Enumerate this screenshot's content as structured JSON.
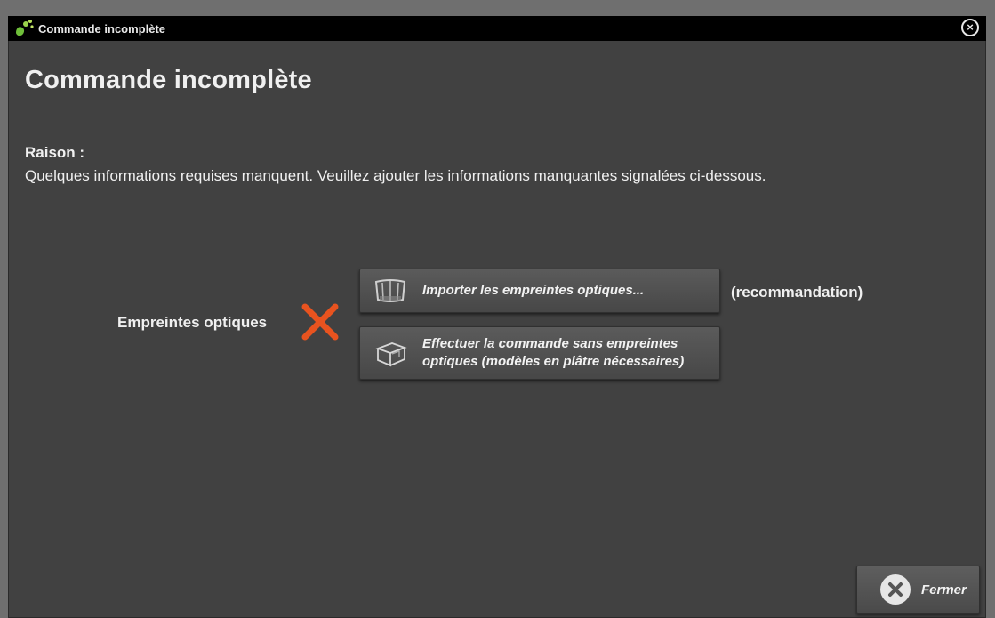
{
  "window": {
    "title": "Commande incomplète",
    "app_icon": "tooth-app-icon",
    "close_icon": "close-circle-icon"
  },
  "main": {
    "heading": "Commande incomplète",
    "reason_label": "Raison :",
    "reason_text": "Quelques informations requises manquent. Veuillez ajouter les informations manquantes signalées ci-dessous."
  },
  "requirement": {
    "label": "Empreintes optiques",
    "status_icon": "missing-x-icon",
    "status_color": "#e8531f",
    "import_button": {
      "label": "Importer les empreintes optiques...",
      "icon": "optical-impressions-icon"
    },
    "recommendation": "(recommandation)",
    "no_impressions_button": {
      "line1": "Effectuer la commande sans empreintes",
      "line2": "optiques (modèles en plâtre nécessaires)",
      "icon": "package-box-icon"
    }
  },
  "footer": {
    "close_button": {
      "label": "Fermer",
      "icon": "close-x-icon"
    }
  }
}
